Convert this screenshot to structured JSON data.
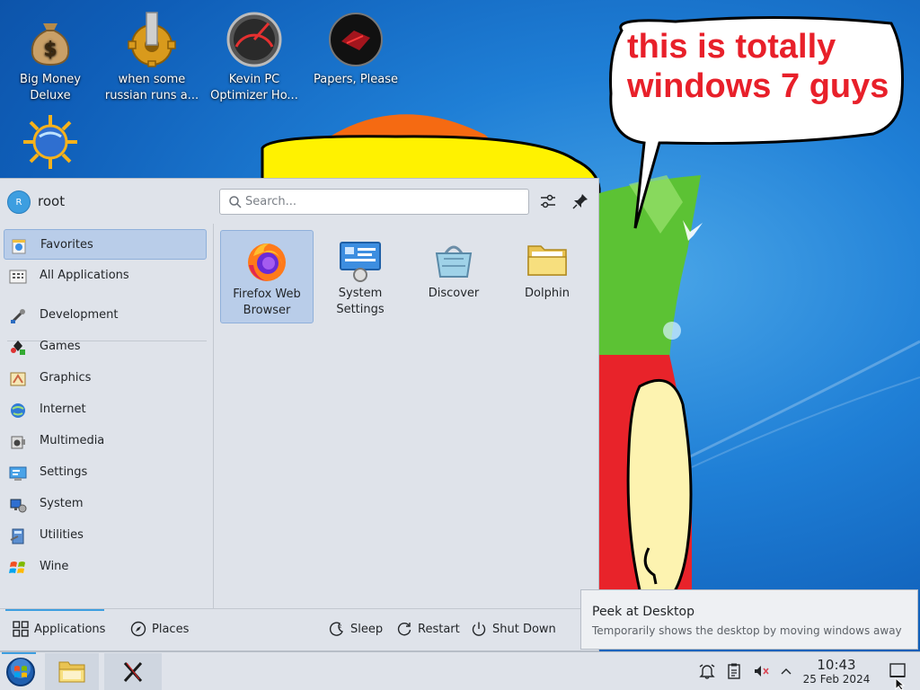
{
  "desktop": {
    "icons": [
      {
        "label": "Big Money Deluxe",
        "icon": "money-bag-icon"
      },
      {
        "label": "when some russian runs a...",
        "icon": "gear-icon"
      },
      {
        "label": "Kevin PC Optimizer Ho...",
        "icon": "speedometer-icon"
      },
      {
        "label": "Papers, Please",
        "icon": "papers-please-icon"
      },
      {
        "label": "",
        "icon": "globe-sun-icon"
      }
    ],
    "speech_bubble": "this is totally windows 7 guys"
  },
  "launcher": {
    "user": {
      "avatar_letter": "R",
      "name": "root"
    },
    "search": {
      "placeholder": "Search..."
    },
    "sidebar": {
      "items": [
        {
          "label": "Favorites",
          "icon": "favorites-icon"
        },
        {
          "label": "All Applications",
          "icon": "grid-icon"
        },
        {
          "label": "Development",
          "icon": "development-icon"
        },
        {
          "label": "Games",
          "icon": "games-icon"
        },
        {
          "label": "Graphics",
          "icon": "graphics-icon"
        },
        {
          "label": "Internet",
          "icon": "internet-icon"
        },
        {
          "label": "Multimedia",
          "icon": "multimedia-icon"
        },
        {
          "label": "Settings",
          "icon": "settings-icon"
        },
        {
          "label": "System",
          "icon": "system-icon"
        },
        {
          "label": "Utilities",
          "icon": "utilities-icon"
        },
        {
          "label": "Wine",
          "icon": "wine-icon"
        }
      ]
    },
    "favorites": [
      {
        "label": "Firefox Web Browser",
        "icon": "firefox-icon"
      },
      {
        "label": "System Settings",
        "icon": "system-settings-icon"
      },
      {
        "label": "Discover",
        "icon": "discover-icon"
      },
      {
        "label": "Dolphin",
        "icon": "folder-icon"
      }
    ],
    "footer": {
      "tabs": [
        {
          "label": "Applications",
          "icon": "applications-icon"
        },
        {
          "label": "Places",
          "icon": "compass-icon"
        }
      ],
      "power": [
        {
          "label": "Sleep",
          "icon": "sleep-icon"
        },
        {
          "label": "Restart",
          "icon": "restart-icon"
        },
        {
          "label": "Shut Down",
          "icon": "power-icon"
        }
      ]
    }
  },
  "tooltip": {
    "title": "Peek at Desktop",
    "body": "Temporarily shows the desktop by moving windows away"
  },
  "taskbar": {
    "clock": {
      "time": "10:43",
      "date": "25 Feb 2024"
    }
  },
  "colors": {
    "accent": "#3d9ee0",
    "selection": "#b9cde9",
    "panel": "#dfe3ea",
    "speech_text": "#e8202a"
  }
}
